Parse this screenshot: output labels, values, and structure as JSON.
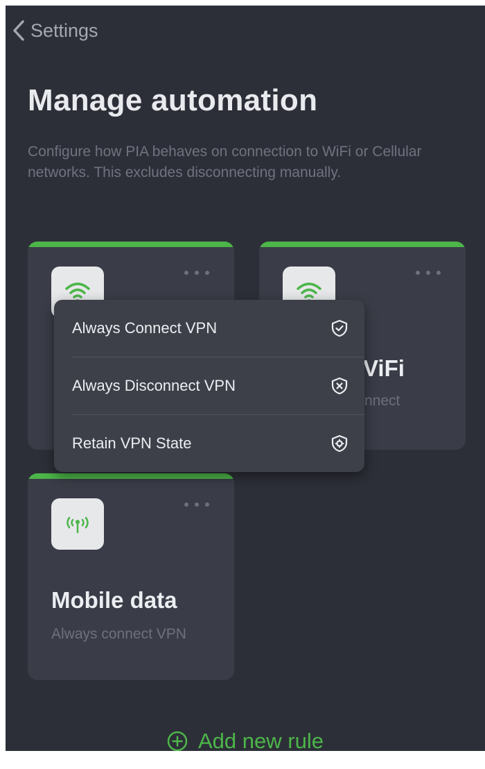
{
  "header": {
    "back_label": "Settings"
  },
  "page": {
    "title": "Manage automation",
    "description": "Configure how PIA behaves on connection to WiFi or Cellular networks. This excludes disconnecting manually."
  },
  "cards": [
    {
      "title": "",
      "subtitle": "",
      "icon": "wifi-icon"
    },
    {
      "title": "ViFi",
      "subtitle": "nnect",
      "icon": "wifi-icon"
    },
    {
      "title": "Mobile data",
      "subtitle": "Always connect VPN",
      "icon": "cellular-antenna-icon"
    }
  ],
  "menu": {
    "items": [
      {
        "label": "Always Connect VPN",
        "icon": "shield-check-icon"
      },
      {
        "label": "Always Disconnect VPN",
        "icon": "shield-x-icon"
      },
      {
        "label": "Retain VPN State",
        "icon": "shield-gear-icon"
      }
    ]
  },
  "footer": {
    "add_rule_label": "Add new rule",
    "icon": "plus-circle-icon"
  },
  "colors": {
    "accent": "#4cb649",
    "background": "#2d2f38",
    "card": "#3a3d47",
    "menu": "#3e4049"
  }
}
